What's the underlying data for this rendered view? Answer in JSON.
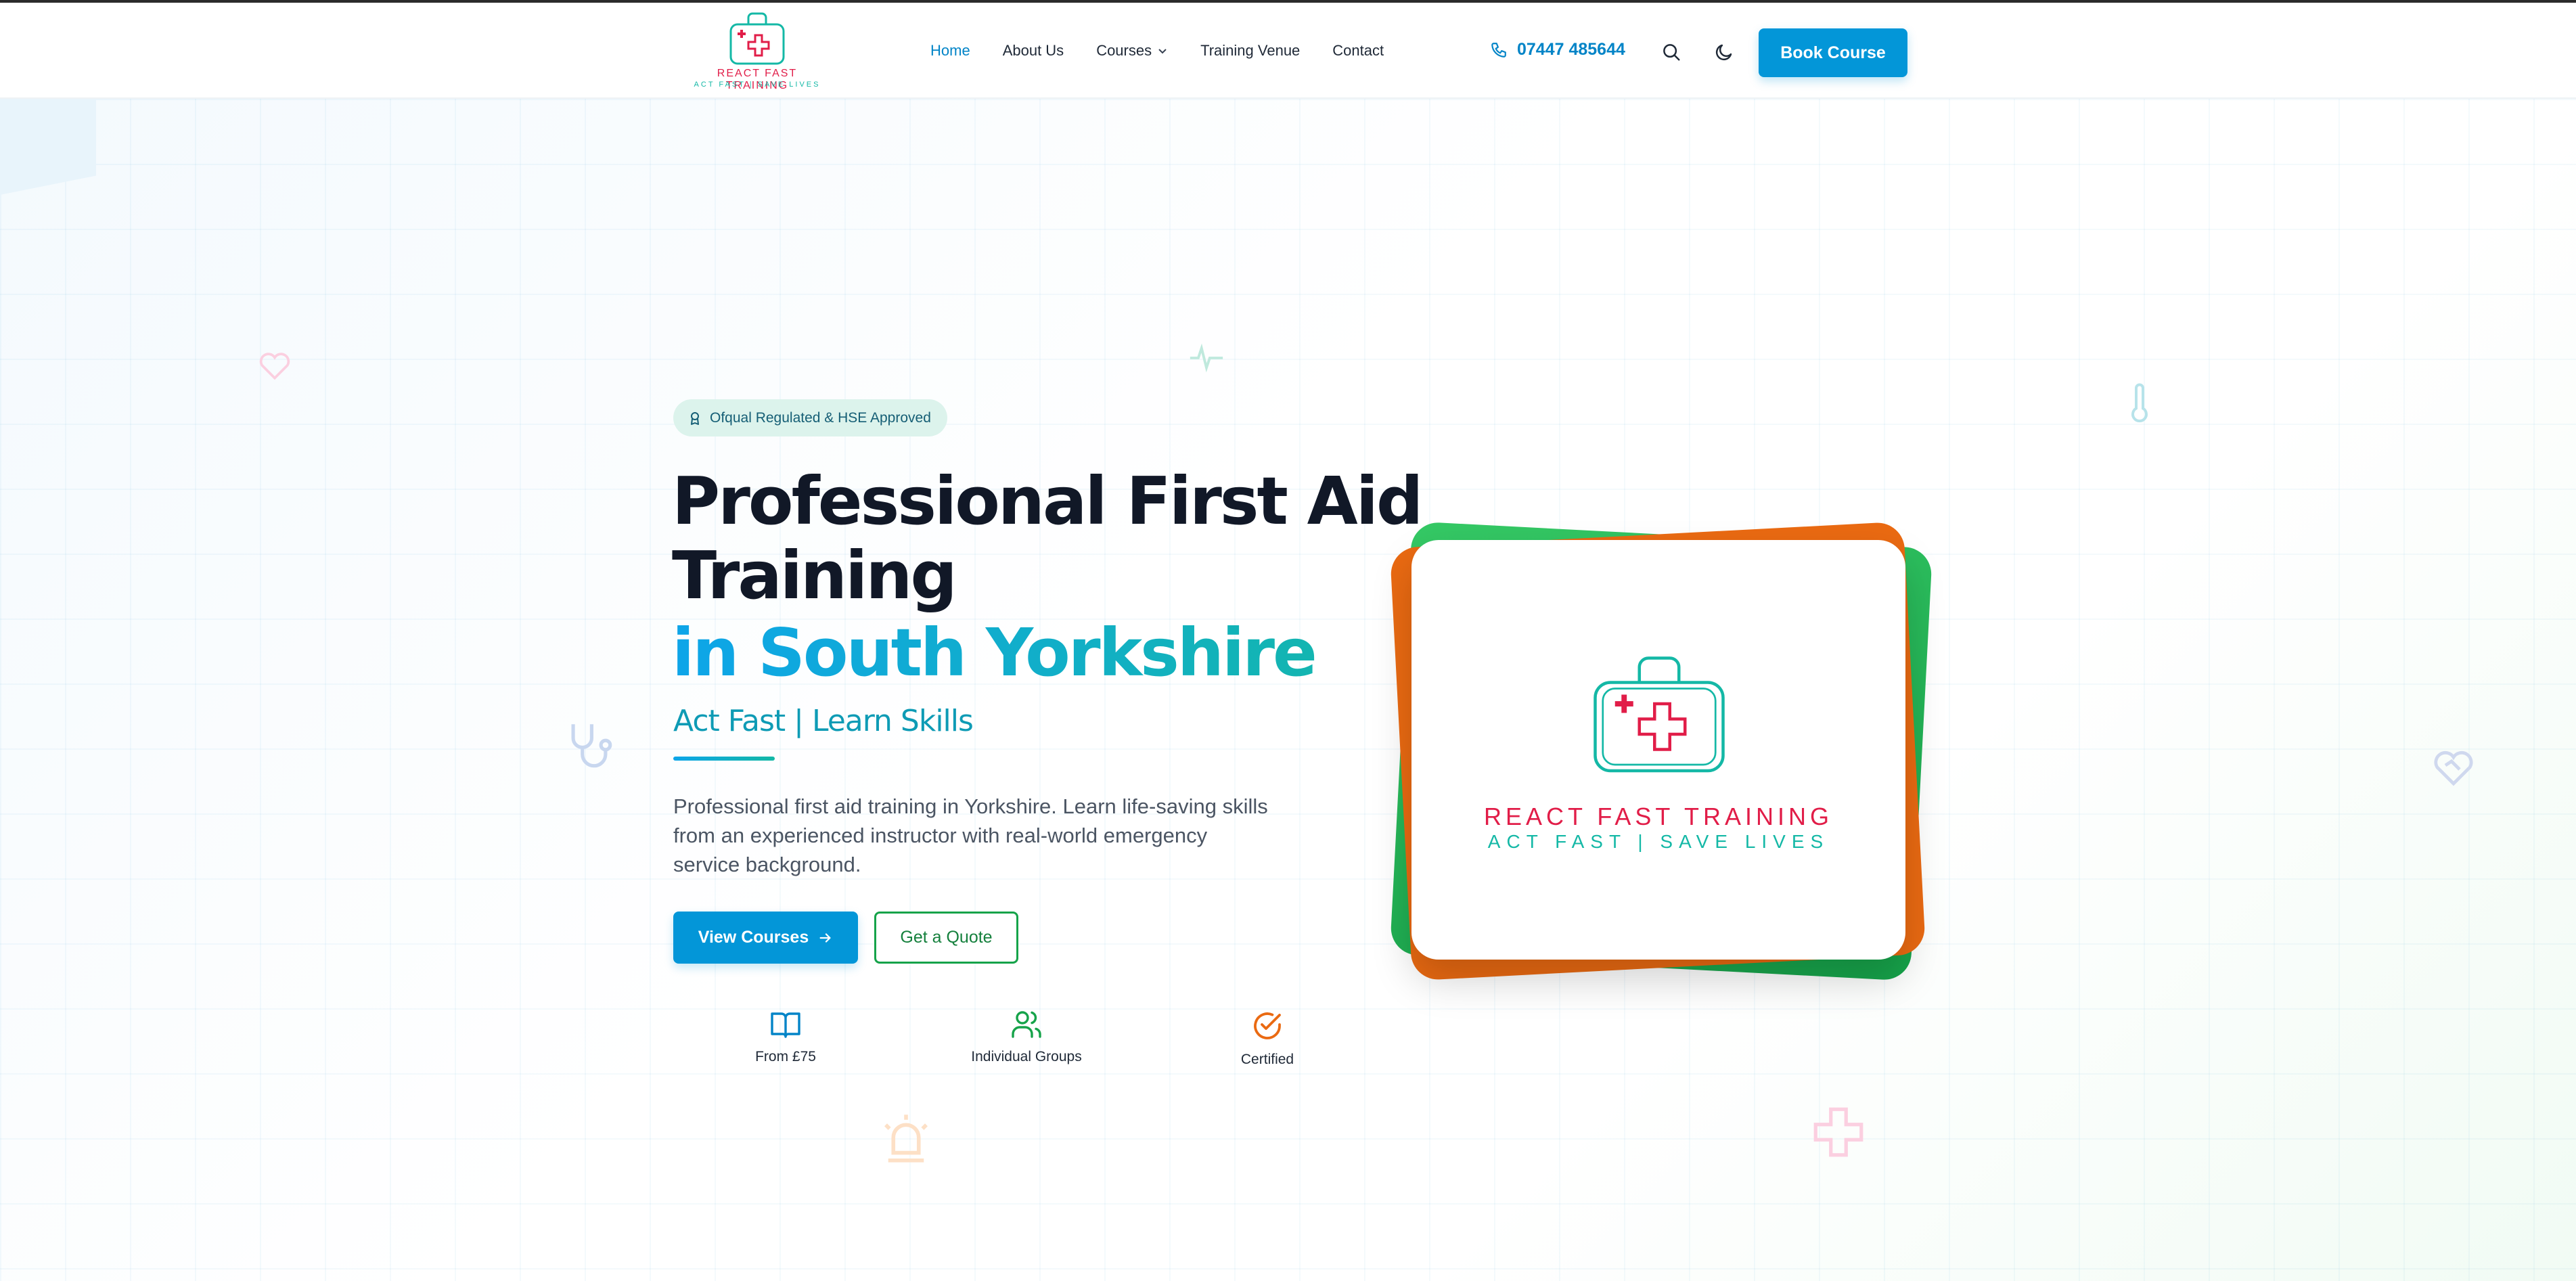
{
  "brand": {
    "name": "REACT FAST TRAINING",
    "slogan": "ACT FAST | SAVE LIVES"
  },
  "nav": {
    "items": [
      {
        "label": "Home",
        "active": true
      },
      {
        "label": "About Us"
      },
      {
        "label": "Courses",
        "dropdown": true
      },
      {
        "label": "Training Venue"
      },
      {
        "label": "Contact"
      }
    ],
    "phone": "07447 485644",
    "book_label": "Book Course"
  },
  "hero": {
    "badge": "Ofqual Regulated & HSE Approved",
    "title_line1": "Professional First Aid",
    "title_line2": "Training",
    "title_highlight": "in South Yorkshire",
    "tagline": "Act Fast | Learn Skills",
    "description": "Professional first aid training in Yorkshire. Learn life-saving skills from an experienced instructor with real-world emergency service background.",
    "primary_cta": "View Courses",
    "secondary_cta": "Get a Quote",
    "features": [
      {
        "icon": "book-icon",
        "label": "From £75"
      },
      {
        "icon": "users-icon",
        "label": "Individual Groups"
      },
      {
        "icon": "check-circle-icon",
        "label": "Certified"
      }
    ]
  },
  "colors": {
    "primary": "#0396d8",
    "accent_teal": "#14b8a6",
    "brand_red": "#e11d48",
    "green": "#16a34a",
    "orange": "#ea6a12"
  }
}
